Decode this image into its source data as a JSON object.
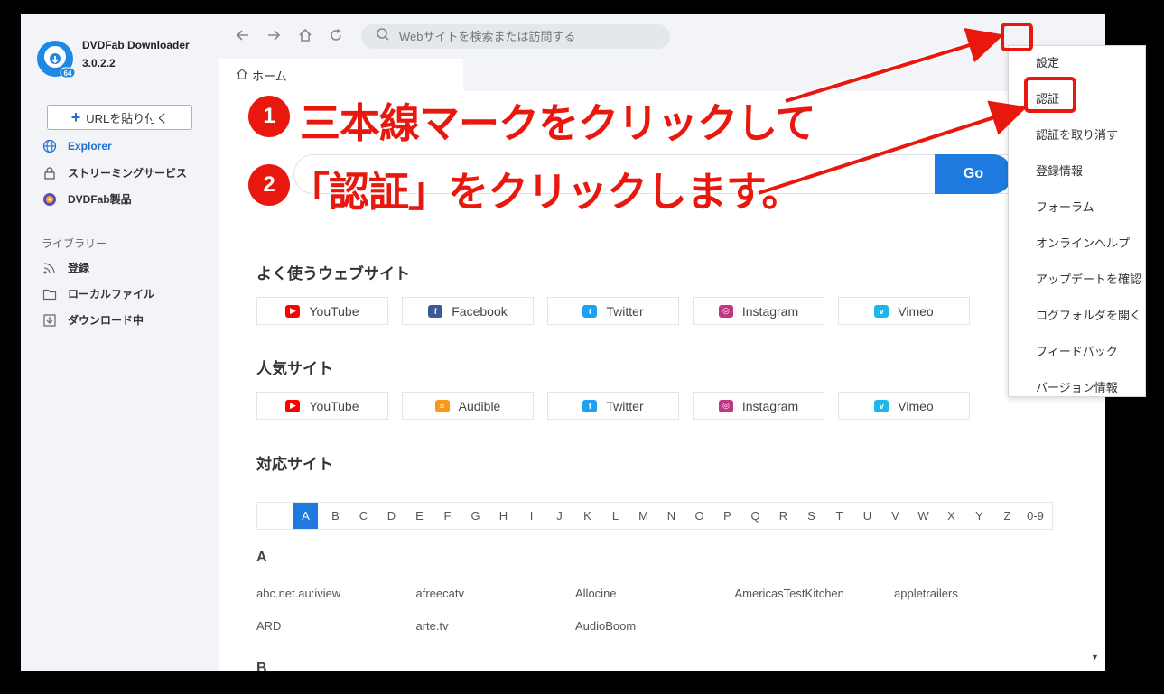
{
  "app": {
    "name": "DVDFab Downloader",
    "version": "3.0.2.2"
  },
  "sidebar": {
    "paste_url_label": "URLを貼り付く",
    "items": [
      {
        "label": "Explorer",
        "icon": "globe-icon"
      },
      {
        "label": "ストリーミングサービス",
        "icon": "lock-icon"
      },
      {
        "label": "DVDFab製品",
        "icon": "dvdfab-icon"
      }
    ],
    "library_label": "ライブラリー",
    "library_items": [
      {
        "label": "登録",
        "icon": "rss-icon"
      },
      {
        "label": "ローカルファイル",
        "icon": "folder-icon"
      },
      {
        "label": "ダウンロード中",
        "icon": "download-icon"
      }
    ]
  },
  "topbar": {
    "url_placeholder": "Webサイトを検索または訪問する"
  },
  "tab": {
    "home_label": "ホーム"
  },
  "main": {
    "go_label": "Go",
    "popular_title": "よく使うウェブサイト",
    "popular_sites": [
      {
        "label": "YouTube",
        "icon": "youtube-icon",
        "color": "#ff0000"
      },
      {
        "label": "Facebook",
        "icon": "facebook-icon",
        "color": "#3b5998"
      },
      {
        "label": "Twitter",
        "icon": "twitter-icon",
        "color": "#1da1f2"
      },
      {
        "label": "Instagram",
        "icon": "instagram-icon",
        "color": "#c13584"
      },
      {
        "label": "Vimeo",
        "icon": "vimeo-icon",
        "color": "#1ab7ea"
      }
    ],
    "trending_title": "人気サイト",
    "trending_sites": [
      {
        "label": "YouTube",
        "icon": "youtube-icon",
        "color": "#ff0000"
      },
      {
        "label": "Audible",
        "icon": "audible-icon",
        "color": "#f8991c"
      },
      {
        "label": "Twitter",
        "icon": "twitter-icon",
        "color": "#1da1f2"
      },
      {
        "label": "Instagram",
        "icon": "instagram-icon",
        "color": "#c13584"
      },
      {
        "label": "Vimeo",
        "icon": "vimeo-icon",
        "color": "#1ab7ea"
      }
    ],
    "supported_title": "対応サイト",
    "alphabet": [
      "A",
      "B",
      "C",
      "D",
      "E",
      "F",
      "G",
      "H",
      "I",
      "J",
      "K",
      "L",
      "M",
      "N",
      "O",
      "P",
      "Q",
      "R",
      "S",
      "T",
      "U",
      "V",
      "W",
      "X",
      "Y",
      "Z",
      "0-9"
    ],
    "active_letter": "A",
    "section_a": "A",
    "sites_a": [
      "abc.net.au:iview",
      "afreecatv",
      "Allocine",
      "AmericasTestKitchen",
      "appletrailers",
      "ARD",
      "arte.tv",
      "AudioBoom"
    ],
    "section_b": "B"
  },
  "dropdown": {
    "items": [
      "設定",
      "認証",
      "認証を取り消す",
      "登録情報",
      "フォーラム",
      "オンラインヘルプ",
      "アップデートを確認",
      "ログフォルダを開く",
      "フィードバック",
      "バージョン情報"
    ]
  },
  "annotations": {
    "step1_num": "1",
    "step1_text": "三本線マークをクリックして",
    "step2_num": "2",
    "step2_text": "「認証」をクリックします。",
    "accent_color": "#e8180e"
  }
}
